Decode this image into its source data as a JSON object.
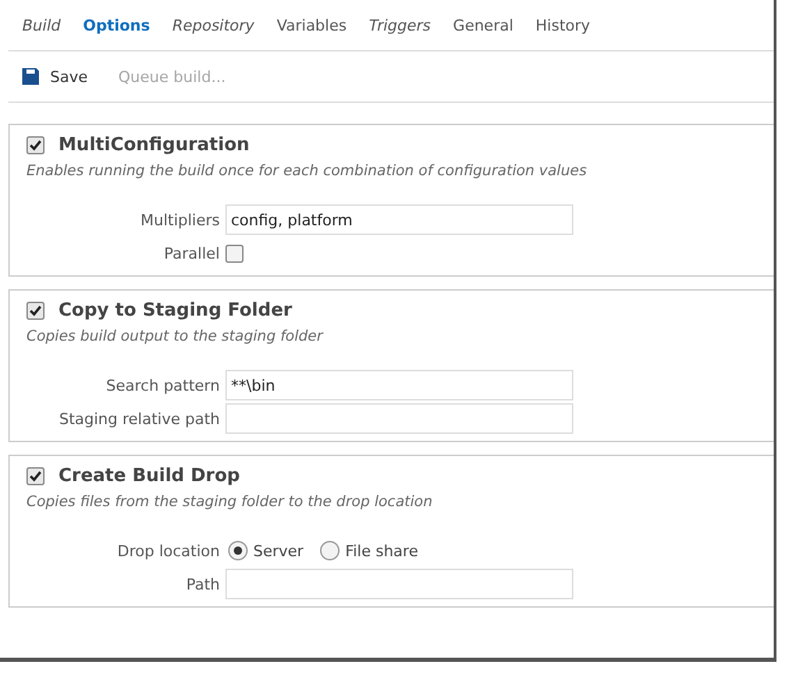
{
  "tabs": [
    {
      "label": "Build",
      "selected": false,
      "modified": true
    },
    {
      "label": "Options",
      "selected": true,
      "modified": false
    },
    {
      "label": "Repository",
      "selected": false,
      "modified": true
    },
    {
      "label": "Variables",
      "selected": false,
      "modified": false
    },
    {
      "label": "Triggers",
      "selected": false,
      "modified": true
    },
    {
      "label": "General",
      "selected": false,
      "modified": false
    },
    {
      "label": "History",
      "selected": false,
      "modified": false
    }
  ],
  "toolbar": [
    {
      "label": "Save",
      "disabled": false,
      "kind": "save"
    },
    {
      "label": "Queue build...",
      "disabled": true,
      "kind": "plain"
    }
  ],
  "sections": [
    {
      "title": "MultiConfiguration",
      "checked": true,
      "description": "Enables running the build once for each combination of configuration values",
      "fields": [
        {
          "kind": "text",
          "label": "Multipliers",
          "value": "config, platform"
        },
        {
          "kind": "checkbox",
          "label": "Parallel",
          "checked": false
        }
      ]
    },
    {
      "title": "Copy to Staging Folder",
      "checked": true,
      "description": "Copies build output to the staging folder",
      "fields": [
        {
          "kind": "text",
          "label": "Search pattern",
          "value": "**\\bin"
        },
        {
          "kind": "text",
          "label": "Staging relative path"
        }
      ]
    },
    {
      "title": "Create Build Drop",
      "checked": true,
      "description": "Copies files from the staging folder to the drop location",
      "fields": [
        {
          "kind": "radio",
          "label": "Drop location",
          "options": [
            {
              "label": "Server",
              "selected": true
            },
            {
              "label": "File share",
              "selected": false
            }
          ]
        },
        {
          "kind": "text",
          "label": "Path"
        }
      ]
    }
  ]
}
